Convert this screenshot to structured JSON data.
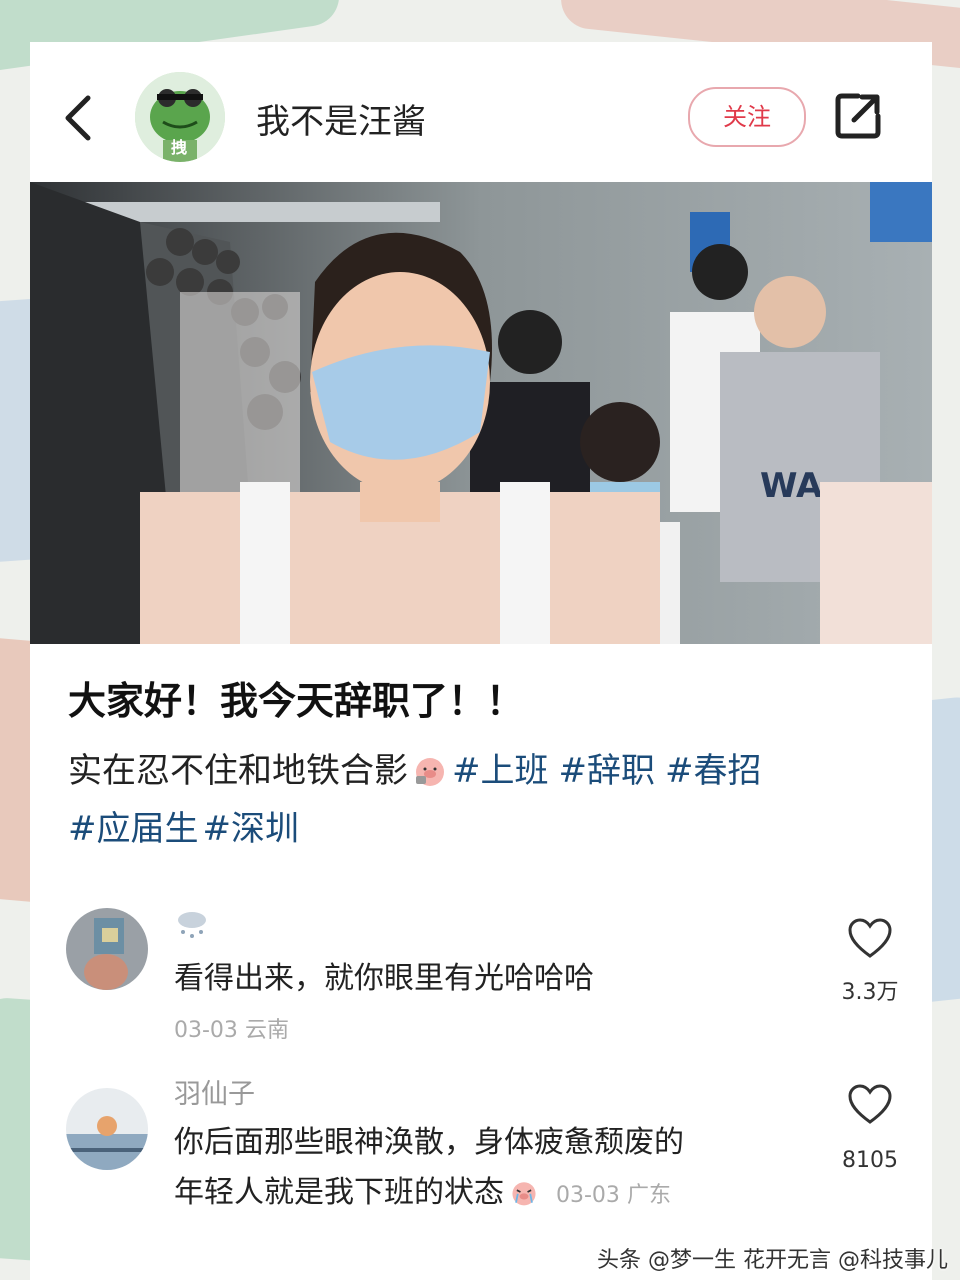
{
  "header": {
    "username": "我不是汪酱",
    "avatar_badge": "拽",
    "follow_label": "关注"
  },
  "post": {
    "title": "大家好！我今天辞职了！！",
    "body_text": "实在忍不住和地铁合影",
    "tags_line1": [
      "#上班",
      "#辞职",
      "#春招"
    ],
    "tags_line2": [
      "#应届生",
      "#深圳"
    ]
  },
  "comments": [
    {
      "text": "看得出来，就你眼里有光哈哈哈",
      "date": "03-03",
      "location": "云南",
      "likes": "3.3万"
    },
    {
      "name": "羽仙子",
      "text_line1": "你后面那些眼神涣散，身体疲惫颓废的",
      "text_line2": "年轻人就是我下班的状态",
      "date": "03-03",
      "location": "广东",
      "likes": "8105"
    }
  ],
  "watermark": "头条 @梦一生 花开无言 @科技事儿",
  "colors": {
    "tag": "#1b4c7a",
    "follow": "#e03a4a"
  }
}
